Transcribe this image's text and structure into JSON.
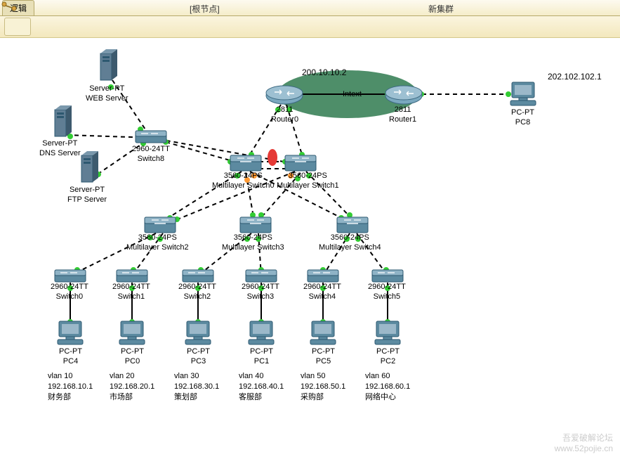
{
  "tabs": {
    "logical": "逻辑",
    "root": "[根节点]",
    "newcluster": "新集群"
  },
  "ip_annotations": {
    "top": "200.10.10.2",
    "right": "202.102.102.1",
    "intext": "Intext"
  },
  "devices": {
    "web": {
      "model": "Server-PT",
      "name": "WEB Server"
    },
    "dns": {
      "model": "Server-PT",
      "name": "DNS Server"
    },
    "ftp": {
      "model": "Server-PT",
      "name": "FTP Server"
    },
    "sw8": {
      "model": "2960-24TT",
      "name": "Switch8"
    },
    "r0": {
      "model": "2811",
      "name": "Router0"
    },
    "r1": {
      "model": "2811",
      "name": "Router1"
    },
    "ms0": {
      "model": "3560-24PS",
      "name": "Multilayer Switch0"
    },
    "ms1": {
      "model": "3560-24PS",
      "name": "Multilayer Switch1"
    },
    "ms2": {
      "model": "3560-24PS",
      "name": "Multilayer Switch2"
    },
    "ms3": {
      "model": "3560-24PS",
      "name": "Multilayer Switch3"
    },
    "ms4": {
      "model": "3560-24PS",
      "name": "Multilayer Switch4"
    },
    "sw0": {
      "model": "2960-24TT",
      "name": "Switch0"
    },
    "sw1": {
      "model": "2960-24TT",
      "name": "Switch1"
    },
    "sw2": {
      "model": "2960-24TT",
      "name": "Switch2"
    },
    "sw3": {
      "model": "2960-24TT",
      "name": "Switch3"
    },
    "sw4": {
      "model": "2960-24TT",
      "name": "Switch4"
    },
    "sw5": {
      "model": "2960-24TT",
      "name": "Switch5"
    },
    "pc4": {
      "model": "PC-PT",
      "name": "PC4"
    },
    "pc0": {
      "model": "PC-PT",
      "name": "PC0"
    },
    "pc3": {
      "model": "PC-PT",
      "name": "PC3"
    },
    "pc1": {
      "model": "PC-PT",
      "name": "PC1"
    },
    "pc5": {
      "model": "PC-PT",
      "name": "PC5"
    },
    "pc2": {
      "model": "PC-PT",
      "name": "PC2"
    },
    "pc8": {
      "model": "PC-PT",
      "name": "PC8"
    }
  },
  "vlans": {
    "v10": {
      "title": "vlan 10",
      "ip": "192.168.10.1",
      "dept": "财务部"
    },
    "v20": {
      "title": "vlan 20",
      "ip": "192.168.20.1",
      "dept": "市场部"
    },
    "v30": {
      "title": "vlan 30",
      "ip": "192.168.30.1",
      "dept": "策划部"
    },
    "v40": {
      "title": "vlan 40",
      "ip": "192.168.40.1",
      "dept": "客服部"
    },
    "v50": {
      "title": "vlan 50",
      "ip": "192.168.50.1",
      "dept": "采购部"
    },
    "v60": {
      "title": "vlan 60",
      "ip": "192.168.60.1",
      "dept": "网络中心"
    }
  },
  "watermark": {
    "line1": "吾爱破解论坛",
    "line2": "www.52pojie.cn"
  },
  "chart_data": {
    "type": "Network topology diagram (Cisco Packet Tracer)",
    "physical_view_tab": "逻辑 (Logical)",
    "root_node_label": "[根节点]",
    "new_cluster_label": "新集群",
    "wan_cloud": {
      "between": [
        "Router0",
        "Router1"
      ],
      "label": "Intext",
      "color": "green-ellipse"
    },
    "external_ips": {
      "Router0_cloud_ip": "200.10.10.2",
      "PC8_ip": "202.102.102.1"
    },
    "nodes": [
      {
        "id": "WEB Server",
        "type": "Server-PT"
      },
      {
        "id": "DNS Server",
        "type": "Server-PT"
      },
      {
        "id": "FTP Server",
        "type": "Server-PT"
      },
      {
        "id": "Switch8",
        "type": "2960-24TT"
      },
      {
        "id": "Router0",
        "type": "2811"
      },
      {
        "id": "Router1",
        "type": "2811"
      },
      {
        "id": "Multilayer Switch0",
        "type": "3560-24PS"
      },
      {
        "id": "Multilayer Switch1",
        "type": "3560-24PS"
      },
      {
        "id": "Multilayer Switch2",
        "type": "3560-24PS"
      },
      {
        "id": "Multilayer Switch3",
        "type": "3560-24PS"
      },
      {
        "id": "Multilayer Switch4",
        "type": "3560-24PS"
      },
      {
        "id": "Switch0",
        "type": "2960-24TT"
      },
      {
        "id": "Switch1",
        "type": "2960-24TT"
      },
      {
        "id": "Switch2",
        "type": "2960-24TT"
      },
      {
        "id": "Switch3",
        "type": "2960-24TT"
      },
      {
        "id": "Switch4",
        "type": "2960-24TT"
      },
      {
        "id": "Switch5",
        "type": "2960-24TT"
      },
      {
        "id": "PC4",
        "type": "PC-PT"
      },
      {
        "id": "PC0",
        "type": "PC-PT"
      },
      {
        "id": "PC3",
        "type": "PC-PT"
      },
      {
        "id": "PC1",
        "type": "PC-PT"
      },
      {
        "id": "PC5",
        "type": "PC-PT"
      },
      {
        "id": "PC2",
        "type": "PC-PT"
      },
      {
        "id": "PC8",
        "type": "PC-PT"
      }
    ],
    "links": [
      {
        "a": "WEB Server",
        "b": "Switch8",
        "style": "dashed"
      },
      {
        "a": "DNS Server",
        "b": "Switch8",
        "style": "dashed"
      },
      {
        "a": "FTP Server",
        "b": "Switch8",
        "style": "dashed"
      },
      {
        "a": "Switch8",
        "b": "Multilayer Switch0",
        "style": "dashed"
      },
      {
        "a": "Switch8",
        "b": "Multilayer Switch1",
        "style": "dashed"
      },
      {
        "a": "Router0",
        "b": "Multilayer Switch0",
        "style": "dashed"
      },
      {
        "a": "Router0",
        "b": "Multilayer Switch1",
        "style": "dashed"
      },
      {
        "a": "Router0",
        "b": "cloud",
        "style": "solid"
      },
      {
        "a": "Router1",
        "b": "cloud",
        "style": "solid"
      },
      {
        "a": "Router1",
        "b": "PC8",
        "style": "dashed"
      },
      {
        "a": "Multilayer Switch0",
        "b": "Multilayer Switch1",
        "style": "dashed",
        "note": "redundant pair with red blocking marker"
      },
      {
        "a": "Multilayer Switch0",
        "b": "Multilayer Switch2",
        "style": "dashed"
      },
      {
        "a": "Multilayer Switch0",
        "b": "Multilayer Switch3",
        "style": "dashed",
        "port_status": "orange"
      },
      {
        "a": "Multilayer Switch0",
        "b": "Multilayer Switch4",
        "style": "dashed",
        "port_status": "orange"
      },
      {
        "a": "Multilayer Switch1",
        "b": "Multilayer Switch2",
        "style": "dashed",
        "port_status": "orange"
      },
      {
        "a": "Multilayer Switch1",
        "b": "Multilayer Switch3",
        "style": "dashed"
      },
      {
        "a": "Multilayer Switch1",
        "b": "Multilayer Switch4",
        "style": "dashed"
      },
      {
        "a": "Multilayer Switch2",
        "b": "Switch0",
        "style": "dashed"
      },
      {
        "a": "Multilayer Switch2",
        "b": "Switch1",
        "style": "dashed"
      },
      {
        "a": "Multilayer Switch3",
        "b": "Switch2",
        "style": "dashed"
      },
      {
        "a": "Multilayer Switch3",
        "b": "Switch3",
        "style": "dashed"
      },
      {
        "a": "Multilayer Switch4",
        "b": "Switch4",
        "style": "dashed"
      },
      {
        "a": "Multilayer Switch4",
        "b": "Switch5",
        "style": "dashed"
      },
      {
        "a": "Switch0",
        "b": "PC4",
        "style": "solid"
      },
      {
        "a": "Switch1",
        "b": "PC0",
        "style": "solid"
      },
      {
        "a": "Switch2",
        "b": "PC3",
        "style": "solid"
      },
      {
        "a": "Switch3",
        "b": "PC1",
        "style": "solid"
      },
      {
        "a": "Switch4",
        "b": "PC5",
        "style": "solid"
      },
      {
        "a": "Switch5",
        "b": "PC2",
        "style": "solid"
      }
    ],
    "vlan_assignments": [
      {
        "vlan": 10,
        "gateway": "192.168.10.1",
        "department": "财务部",
        "pc": "PC4"
      },
      {
        "vlan": 20,
        "gateway": "192.168.20.1",
        "department": "市场部",
        "pc": "PC0"
      },
      {
        "vlan": 30,
        "gateway": "192.168.30.1",
        "department": "策划部",
        "pc": "PC3"
      },
      {
        "vlan": 40,
        "gateway": "192.168.40.1",
        "department": "客服部",
        "pc": "PC1"
      },
      {
        "vlan": 50,
        "gateway": "192.168.50.1",
        "department": "采购部",
        "pc": "PC5"
      },
      {
        "vlan": 60,
        "gateway": "192.168.60.1",
        "department": "网络中心",
        "pc": "PC2"
      }
    ]
  }
}
